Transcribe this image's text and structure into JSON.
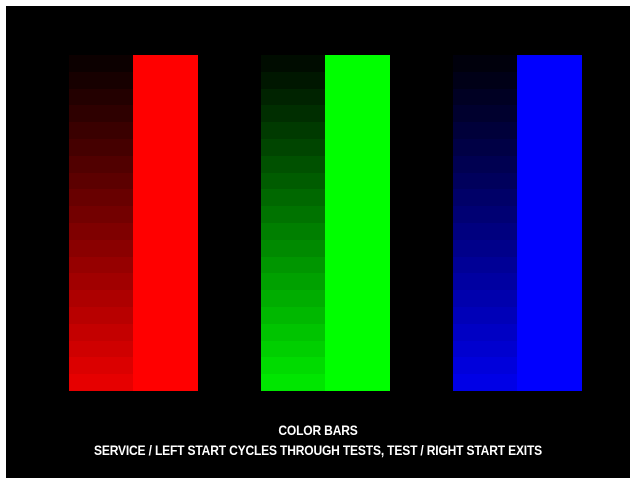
{
  "screen": {
    "background": "#000000",
    "title": "COLOR BARS",
    "instructions": "SERVICE / LEFT START CYCLES THROUGH TESTS, TEST / RIGHT START EXITS"
  },
  "color_bars": [
    {
      "name": "red",
      "color": "#ff0000",
      "gradient_steps": 20,
      "channel": "r"
    },
    {
      "name": "green",
      "color": "#00ff00",
      "gradient_steps": 20,
      "channel": "g"
    },
    {
      "name": "blue",
      "color": "#0000ff",
      "gradient_steps": 20,
      "channel": "b"
    }
  ]
}
